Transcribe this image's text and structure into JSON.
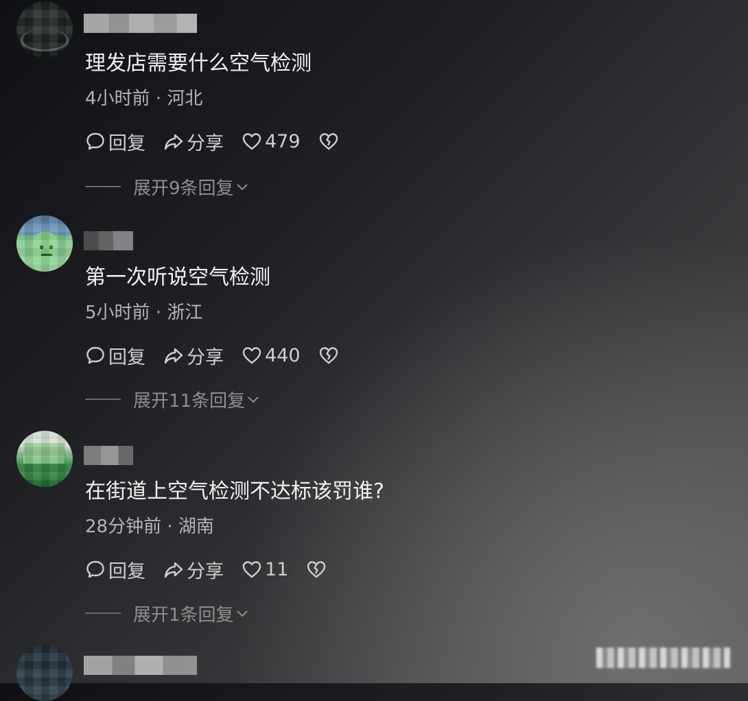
{
  "comments": [
    {
      "text": "理发店需要什么空气检测",
      "time": "4小时前",
      "location": "河北",
      "reply_label": "回复",
      "share_label": "分享",
      "likes": "479",
      "expand_label": "展开9条回复"
    },
    {
      "text": "第一次听说空气检测",
      "time": "5小时前",
      "location": "浙江",
      "reply_label": "回复",
      "share_label": "分享",
      "likes": "440",
      "expand_label": "展开11条回复"
    },
    {
      "text": "在街道上空气检测不达标该罚谁?",
      "time": "28分钟前",
      "location": "湖南",
      "reply_label": "回复",
      "share_label": "分享",
      "likes": "11",
      "expand_label": "展开1条回复"
    }
  ],
  "meta_separator": " · ",
  "icons": {
    "reply": "comment-bubble-icon",
    "share": "share-arrow-icon",
    "like": "heart-icon",
    "dislike": "broken-heart-icon",
    "expand": "chevron-down-icon"
  },
  "colors": {
    "text_primary": "#f2f2f2",
    "text_secondary": "#b5b5b5",
    "text_muted": "#8e8e8e"
  }
}
